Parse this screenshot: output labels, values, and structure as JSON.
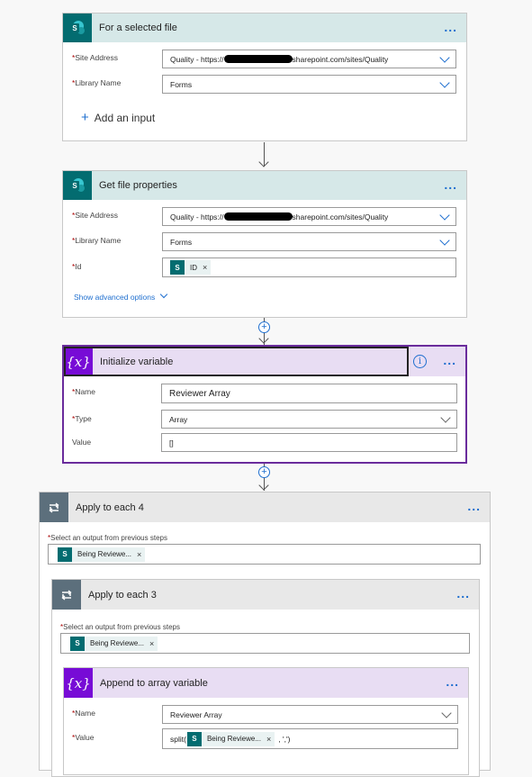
{
  "card1": {
    "title": "For a selected file",
    "site_label": "Site Address",
    "site_value_prefix": "Quality - https://",
    "site_value_suffix": "sharepoint.com/sites/Quality",
    "library_label": "Library Name",
    "library_value": "Forms",
    "add_input_label": "Add an input"
  },
  "card2": {
    "title": "Get file properties",
    "site_label": "Site Address",
    "site_value_prefix": "Quality - https://",
    "site_value_suffix": "sharepoint.com/sites/Quality",
    "library_label": "Library Name",
    "library_value": "Forms",
    "id_label": "Id",
    "id_token": "ID",
    "advanced_label": "Show advanced options"
  },
  "card3": {
    "title": "Initialize variable",
    "icon_text": "{x}",
    "name_label": "Name",
    "name_value": "Reviewer Array",
    "type_label": "Type",
    "type_value": "Array",
    "value_label": "Value",
    "value_value": "[]"
  },
  "card4": {
    "title": "Apply to each 4",
    "select_label": "Select an output from previous steps",
    "token": "Being Reviewe..."
  },
  "card5": {
    "title": "Apply to each 3",
    "select_label": "Select an output from previous steps",
    "token": "Being Reviewe..."
  },
  "card6": {
    "title": "Append to array variable",
    "icon_text": "{x}",
    "name_label": "Name",
    "name_value": "Reviewer Array",
    "value_label": "Value",
    "value_prefix": "split(",
    "value_token": "Being Reviewe...",
    "value_suffix": ", ',')"
  },
  "common": {
    "required_mark": "*",
    "more_icon": "...",
    "token_close": "×",
    "plus": "+",
    "sp_letter": "S"
  },
  "colors": {
    "sharepoint": "#036c70",
    "variable": "#770bd6",
    "loop": "#5c6f7c",
    "accent": "#1f6fcf"
  }
}
